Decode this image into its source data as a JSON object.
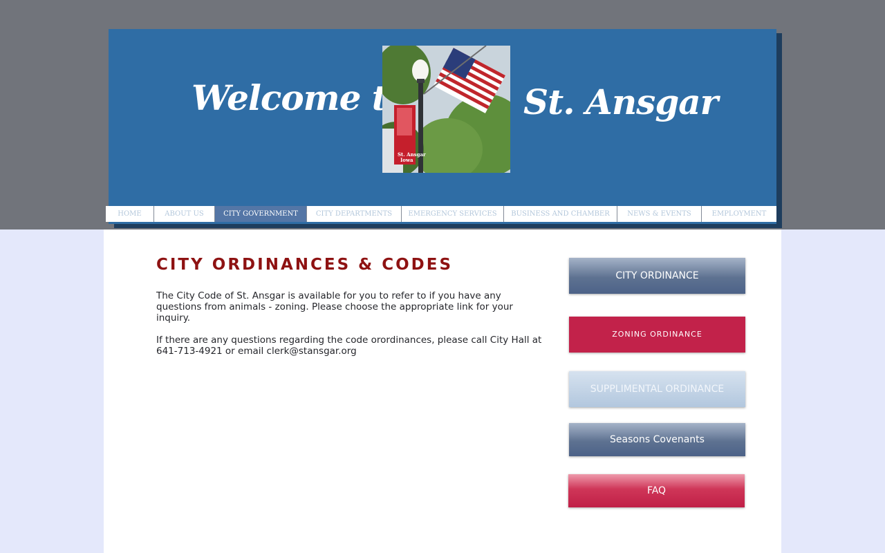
{
  "header": {
    "welcome_text": "Welcome to",
    "city_name": "St. Ansgar",
    "banner_top_text": "Welcome",
    "banner_bottom_text": "St. Ansgar",
    "banner_bottom_sub": "Iowa"
  },
  "nav": {
    "items": [
      {
        "label": "HOME"
      },
      {
        "label": "ABOUT US"
      },
      {
        "label": "CITY GOVERNMENT",
        "active": true
      },
      {
        "label": "CITY DEPARTMENTS"
      },
      {
        "label": "EMERGENCY SERVICES"
      },
      {
        "label": "BUSINESS AND CHAMBER"
      },
      {
        "label": "NEWS & EVENTS"
      },
      {
        "label": "EMPLOYMENT"
      }
    ]
  },
  "main": {
    "title": "CITY ORDINANCES & CODES",
    "paragraph1": "The City Code of St. Ansgar is available for you to refer to if you have any questions from animals - zoning.  Please choose the appropriate link for your inquiry.",
    "paragraph2": "If there are any questions regarding the code orordinances, please call City Hall at 641-713-4921 or email clerk@stansgar.org"
  },
  "sidebar": {
    "city_ordinance": "CITY ORDINANCE",
    "zoning_ordinance": "ZONING ORDINANCE",
    "supplimental_ordinance": "SUPPLIMENTAL ORDINANCE",
    "seasons_covenants": "Seasons Covenants",
    "faq": "FAQ"
  },
  "colors": {
    "header_blue": "#2f6da5",
    "title_red": "#8e1212",
    "zoning_red": "#c2224a",
    "nav_active": "#5476a6"
  }
}
